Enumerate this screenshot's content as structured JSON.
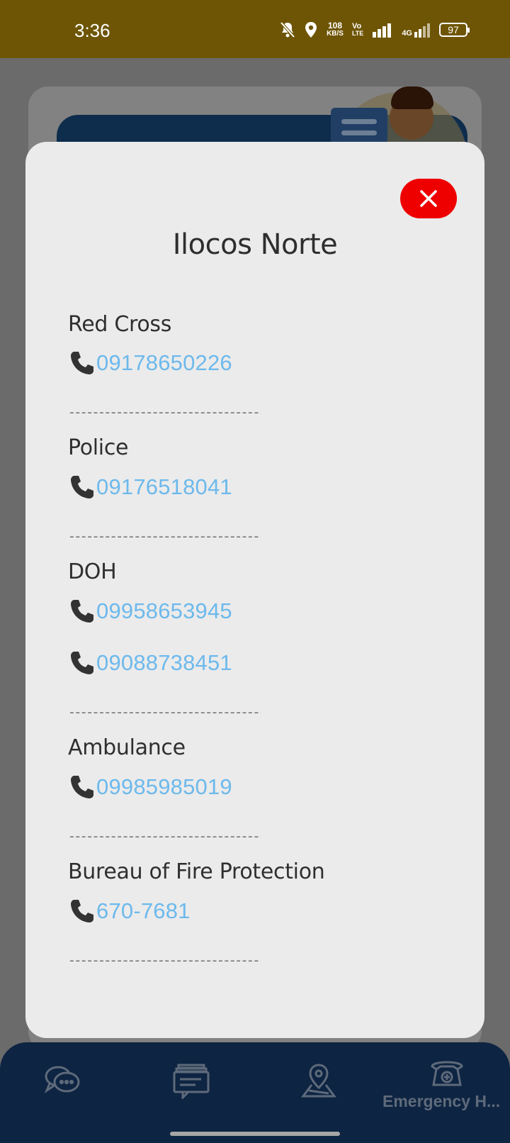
{
  "status_bar": {
    "time": "3:36",
    "net_speed_value": "108",
    "net_speed_unit": "KB/S",
    "volte_top": "Vo",
    "volte_bottom": "LTE",
    "lte": "4G",
    "battery": "97"
  },
  "modal": {
    "title": "Ilocos Norte",
    "divider": "------------------------------------",
    "entries": [
      {
        "name": "Red Cross",
        "phones": [
          "09178650226"
        ]
      },
      {
        "name": "Police",
        "phones": [
          "09176518041"
        ]
      },
      {
        "name": "DOH",
        "phones": [
          "09958653945",
          "09088738451"
        ]
      },
      {
        "name": "Ambulance",
        "phones": [
          "09985985019"
        ]
      },
      {
        "name": "Bureau of Fire Protection",
        "phones": [
          "670-7681"
        ]
      }
    ]
  },
  "bottom_nav": {
    "items": [
      {
        "icon": "chat-bubbles-icon"
      },
      {
        "icon": "message-stack-icon"
      },
      {
        "icon": "map-pin-icon"
      },
      {
        "icon": "emergency-phone-icon",
        "label": "Emergency H..."
      }
    ]
  },
  "colors": {
    "status_bar": "#6e5505",
    "close_button": "#ee0000",
    "phone_link": "#6db9ec",
    "nav_bg": "#0d2442"
  }
}
